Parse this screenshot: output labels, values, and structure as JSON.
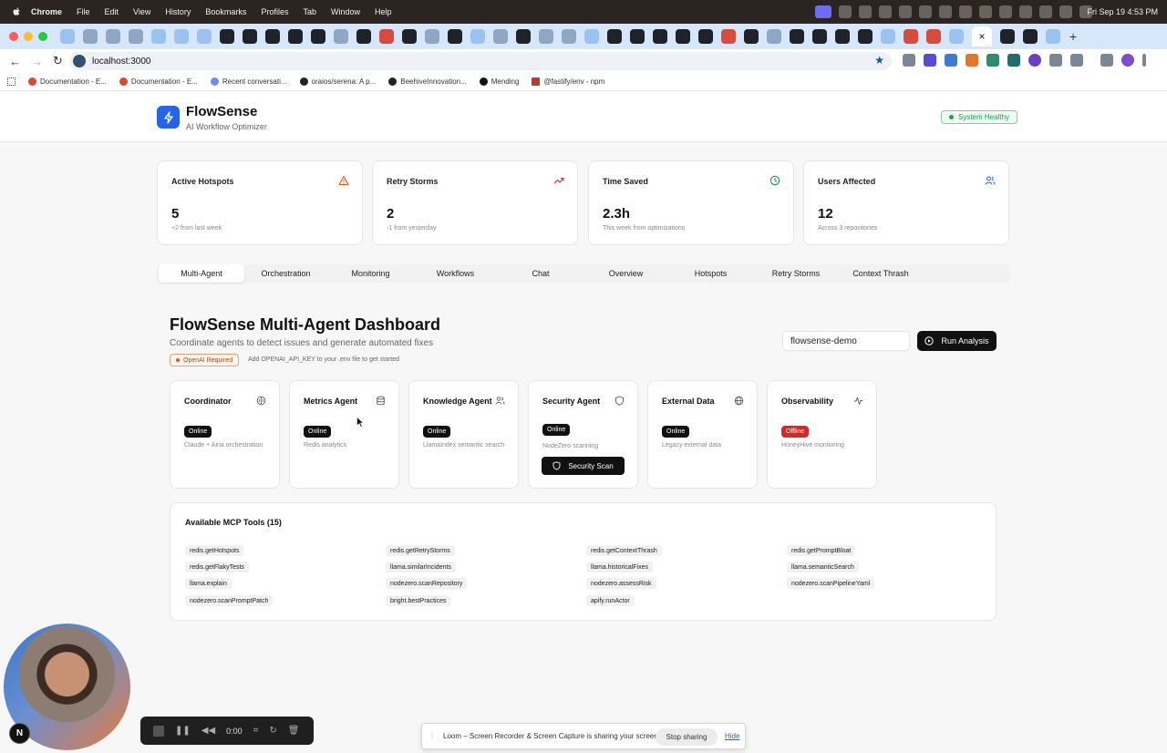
{
  "menubar": {
    "app": "Chrome",
    "items": [
      "File",
      "Edit",
      "View",
      "History",
      "Bookmarks",
      "Profiles",
      "Tab",
      "Window",
      "Help"
    ],
    "clock": "Fri Sep 19  4:53 PM"
  },
  "browser": {
    "url": "localhost:3000",
    "new_tab": "+",
    "close_tab": "×",
    "bookmarks": [
      {
        "label": "Documentation - E...",
        "color": "#e0452f"
      },
      {
        "label": "Documentation - E...",
        "color": "#e0452f"
      },
      {
        "label": "Recent conversati...",
        "color": "#6b8df0"
      },
      {
        "label": "oraios/serena: A p...",
        "color": "#222222"
      },
      {
        "label": "BeehiveInnovation...",
        "color": "#222222"
      },
      {
        "label": "Mending",
        "color": "#111111"
      },
      {
        "label": "@fastify/env - npm",
        "color": "#c0392b"
      }
    ]
  },
  "header": {
    "brand": "FlowSense",
    "subtitle": "AI Workflow Optimizer",
    "status": "System Healthy"
  },
  "stats": [
    {
      "title": "Active Hotspots",
      "value": "5",
      "sub": "+2 from last week",
      "icon": "warning-icon",
      "color": "#ea580c"
    },
    {
      "title": "Retry Storms",
      "value": "2",
      "sub": "-1 from yesterday",
      "icon": "trending-up-icon",
      "color": "#dc2626"
    },
    {
      "title": "Time Saved",
      "value": "2.3h",
      "sub": "This week from optimizations",
      "icon": "clock-icon",
      "color": "#16a34a"
    },
    {
      "title": "Users Affected",
      "value": "12",
      "sub": "Across 3 repositories",
      "icon": "users-icon",
      "color": "#2563eb"
    }
  ],
  "nav_tabs": [
    "Multi-Agent",
    "Orchestration",
    "Monitoring",
    "Workflows",
    "Chat",
    "Overview",
    "Hotspots",
    "Retry Storms",
    "Context Thrash"
  ],
  "active_tab": "Multi-Agent",
  "dashboard": {
    "title": "FlowSense Multi-Agent Dashboard",
    "subtitle": "Coordinate agents to detect issues and generate automated fixes",
    "openai_badge": "OpenAI Required",
    "openai_hint": "Add OPENAI_API_KEY to your .env file to get started",
    "repo_value": "flowsense-demo",
    "run_label": "Run Analysis"
  },
  "agents": [
    {
      "name": "Coordinator",
      "status": "Online",
      "desc": "Claude + Airia orchestration",
      "icon": "brain-icon"
    },
    {
      "name": "Metrics Agent",
      "status": "Online",
      "desc": "Redis analytics",
      "icon": "database-icon"
    },
    {
      "name": "Knowledge Agent",
      "status": "Online",
      "desc": "LlamaIndex semantic search",
      "icon": "users-icon"
    },
    {
      "name": "Security Agent",
      "status": "Online",
      "desc": "NodeZero scanning",
      "icon": "shield-icon",
      "action": "Security Scan"
    },
    {
      "name": "External Data",
      "status": "Online",
      "desc": "Legacy external data",
      "icon": "globe-icon"
    },
    {
      "name": "Observability",
      "status": "Offline",
      "desc": "HoneyHive monitoring",
      "icon": "activity-icon"
    }
  ],
  "mcp": {
    "title": "Available MCP Tools (15)",
    "tools": [
      "redis.getHotspots",
      "redis.getRetryStorms",
      "redis.getContextThrash",
      "redis.getPromptBloat",
      "redis.getFlakyTests",
      "llama.similarIncidents",
      "llama.historicalFixes",
      "llama.semanticSearch",
      "llama.explain",
      "nodezero.scanRepository",
      "nodezero.assessRisk",
      "nodezero.scanPipelineYaml",
      "nodezero.scanPromptPatch",
      "bright.bestPractices",
      "apify.runActor"
    ]
  },
  "recorder": {
    "time": "0:00",
    "avatar_letter": "N",
    "share_text": "Loom – Screen Recorder & Screen Capture is sharing your screen.",
    "stop_label": "Stop sharing",
    "hide_label": "Hide"
  },
  "colors": {
    "accent": "#2563eb",
    "online": "#111111",
    "offline": "#dc2626",
    "healthy": "#16a34a"
  }
}
